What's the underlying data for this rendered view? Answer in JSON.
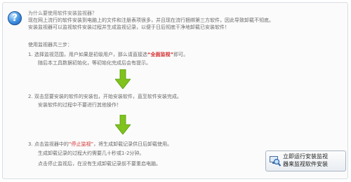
{
  "question": "为什么要使用软件安装监视器？",
  "intro_line1": "现在网上流行的软件安装到电脑上的文件和注册表项很多，并且现在流行捆绑第三方软件，因此导致卸载不彻底。",
  "intro_line2": "安装监视器可以监视软件安装过程并生成监视记录，以便于日后彻底干净地卸载已安装软件！",
  "steps_title": "使用监视器共三步：",
  "step1": {
    "prefix": "1. 选择监视范围，用户如果是初级用户，那么请直接选",
    "highlight": "“全面监视”",
    "suffix": "即可。",
    "note": "随后本工具数据初始化，等初始化完成后会有提示。"
  },
  "step2": {
    "text": "2. 双击您要安装的软件的安装包，开始安装软件，直至软件安装完成。",
    "note": "安装软件的过程中不要进行其他操作！"
  },
  "step3": {
    "prefix": "3. 点击监视器中的",
    "highlight": "“停止监视”",
    "suffix": "，将生成卸载记录供日后卸载使用。",
    "note1": "生成卸载记录的过程大约需要几十秒或1-2分钟。",
    "note2": "点击停止监视后，在没有生成卸载记录前不要重启电脑。"
  },
  "action_button": {
    "line1": "立即运行安装监视",
    "line2": "器来监视软件安装"
  },
  "colors": {
    "highlight": "#d22a2a",
    "arrow": "#7fc31c",
    "help_icon": "#3d8fe0"
  },
  "icons": {
    "help": "question-mark-icon",
    "arrow": "green-down-arrow-icon",
    "action": "monitor-magnifier-icon"
  }
}
